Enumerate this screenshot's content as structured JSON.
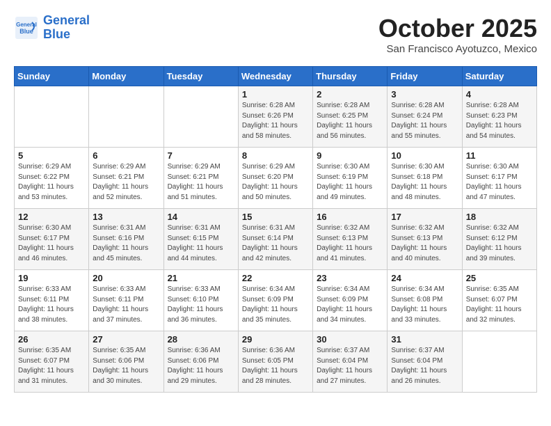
{
  "header": {
    "logo_line1": "General",
    "logo_line2": "Blue",
    "title": "October 2025",
    "subtitle": "San Francisco Ayotuzco, Mexico"
  },
  "weekdays": [
    "Sunday",
    "Monday",
    "Tuesday",
    "Wednesday",
    "Thursday",
    "Friday",
    "Saturday"
  ],
  "weeks": [
    [
      {
        "day": "",
        "info": ""
      },
      {
        "day": "",
        "info": ""
      },
      {
        "day": "",
        "info": ""
      },
      {
        "day": "1",
        "info": "Sunrise: 6:28 AM\nSunset: 6:26 PM\nDaylight: 11 hours\nand 58 minutes."
      },
      {
        "day": "2",
        "info": "Sunrise: 6:28 AM\nSunset: 6:25 PM\nDaylight: 11 hours\nand 56 minutes."
      },
      {
        "day": "3",
        "info": "Sunrise: 6:28 AM\nSunset: 6:24 PM\nDaylight: 11 hours\nand 55 minutes."
      },
      {
        "day": "4",
        "info": "Sunrise: 6:28 AM\nSunset: 6:23 PM\nDaylight: 11 hours\nand 54 minutes."
      }
    ],
    [
      {
        "day": "5",
        "info": "Sunrise: 6:29 AM\nSunset: 6:22 PM\nDaylight: 11 hours\nand 53 minutes."
      },
      {
        "day": "6",
        "info": "Sunrise: 6:29 AM\nSunset: 6:21 PM\nDaylight: 11 hours\nand 52 minutes."
      },
      {
        "day": "7",
        "info": "Sunrise: 6:29 AM\nSunset: 6:21 PM\nDaylight: 11 hours\nand 51 minutes."
      },
      {
        "day": "8",
        "info": "Sunrise: 6:29 AM\nSunset: 6:20 PM\nDaylight: 11 hours\nand 50 minutes."
      },
      {
        "day": "9",
        "info": "Sunrise: 6:30 AM\nSunset: 6:19 PM\nDaylight: 11 hours\nand 49 minutes."
      },
      {
        "day": "10",
        "info": "Sunrise: 6:30 AM\nSunset: 6:18 PM\nDaylight: 11 hours\nand 48 minutes."
      },
      {
        "day": "11",
        "info": "Sunrise: 6:30 AM\nSunset: 6:17 PM\nDaylight: 11 hours\nand 47 minutes."
      }
    ],
    [
      {
        "day": "12",
        "info": "Sunrise: 6:30 AM\nSunset: 6:17 PM\nDaylight: 11 hours\nand 46 minutes."
      },
      {
        "day": "13",
        "info": "Sunrise: 6:31 AM\nSunset: 6:16 PM\nDaylight: 11 hours\nand 45 minutes."
      },
      {
        "day": "14",
        "info": "Sunrise: 6:31 AM\nSunset: 6:15 PM\nDaylight: 11 hours\nand 44 minutes."
      },
      {
        "day": "15",
        "info": "Sunrise: 6:31 AM\nSunset: 6:14 PM\nDaylight: 11 hours\nand 42 minutes."
      },
      {
        "day": "16",
        "info": "Sunrise: 6:32 AM\nSunset: 6:13 PM\nDaylight: 11 hours\nand 41 minutes."
      },
      {
        "day": "17",
        "info": "Sunrise: 6:32 AM\nSunset: 6:13 PM\nDaylight: 11 hours\nand 40 minutes."
      },
      {
        "day": "18",
        "info": "Sunrise: 6:32 AM\nSunset: 6:12 PM\nDaylight: 11 hours\nand 39 minutes."
      }
    ],
    [
      {
        "day": "19",
        "info": "Sunrise: 6:33 AM\nSunset: 6:11 PM\nDaylight: 11 hours\nand 38 minutes."
      },
      {
        "day": "20",
        "info": "Sunrise: 6:33 AM\nSunset: 6:11 PM\nDaylight: 11 hours\nand 37 minutes."
      },
      {
        "day": "21",
        "info": "Sunrise: 6:33 AM\nSunset: 6:10 PM\nDaylight: 11 hours\nand 36 minutes."
      },
      {
        "day": "22",
        "info": "Sunrise: 6:34 AM\nSunset: 6:09 PM\nDaylight: 11 hours\nand 35 minutes."
      },
      {
        "day": "23",
        "info": "Sunrise: 6:34 AM\nSunset: 6:09 PM\nDaylight: 11 hours\nand 34 minutes."
      },
      {
        "day": "24",
        "info": "Sunrise: 6:34 AM\nSunset: 6:08 PM\nDaylight: 11 hours\nand 33 minutes."
      },
      {
        "day": "25",
        "info": "Sunrise: 6:35 AM\nSunset: 6:07 PM\nDaylight: 11 hours\nand 32 minutes."
      }
    ],
    [
      {
        "day": "26",
        "info": "Sunrise: 6:35 AM\nSunset: 6:07 PM\nDaylight: 11 hours\nand 31 minutes."
      },
      {
        "day": "27",
        "info": "Sunrise: 6:35 AM\nSunset: 6:06 PM\nDaylight: 11 hours\nand 30 minutes."
      },
      {
        "day": "28",
        "info": "Sunrise: 6:36 AM\nSunset: 6:06 PM\nDaylight: 11 hours\nand 29 minutes."
      },
      {
        "day": "29",
        "info": "Sunrise: 6:36 AM\nSunset: 6:05 PM\nDaylight: 11 hours\nand 28 minutes."
      },
      {
        "day": "30",
        "info": "Sunrise: 6:37 AM\nSunset: 6:04 PM\nDaylight: 11 hours\nand 27 minutes."
      },
      {
        "day": "31",
        "info": "Sunrise: 6:37 AM\nSunset: 6:04 PM\nDaylight: 11 hours\nand 26 minutes."
      },
      {
        "day": "",
        "info": ""
      }
    ]
  ]
}
